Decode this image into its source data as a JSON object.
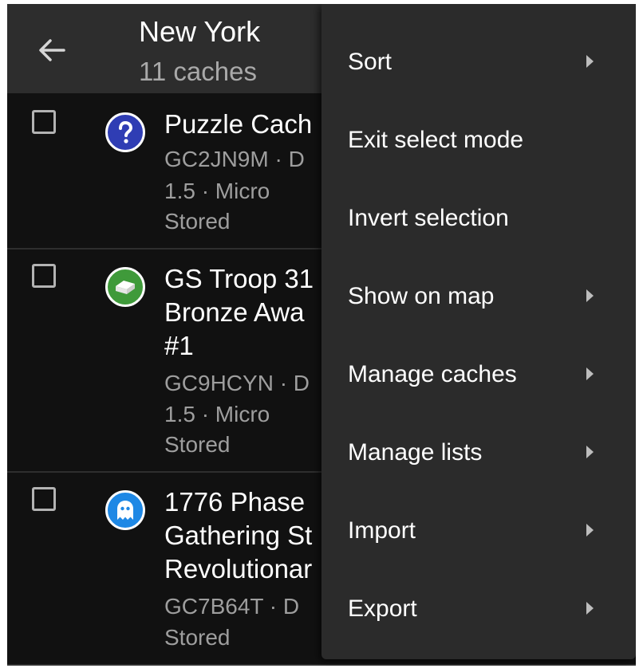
{
  "appbar": {
    "title": "New York",
    "subtitle": "11 caches",
    "back_icon": "arrow-left-icon"
  },
  "caches": [
    {
      "name": "Puzzle Cach",
      "details": [
        "GC2JN9M · D",
        "1.5 · Micro",
        "Stored"
      ],
      "type_icon": "question-mark-icon",
      "icon_color": "#2f3db4",
      "checked": false
    },
    {
      "name_lines": [
        "GS Troop 31",
        "Bronze Awa",
        "#1"
      ],
      "details": [
        "GC9HCYN · D",
        "1.5 · Micro",
        "Stored"
      ],
      "type_icon": "traditional-box-icon",
      "icon_color": "#3f9a3a",
      "checked": false
    },
    {
      "name_lines": [
        "1776 Phase",
        "Gathering St",
        "Revolutionar"
      ],
      "details": [
        "GC7B64T · D",
        "Stored"
      ],
      "type_icon": "ghost-icon",
      "icon_color": "#1e88e5",
      "checked": false
    }
  ],
  "menu": {
    "items": [
      {
        "label": "Sort",
        "has_submenu": true
      },
      {
        "label": "Exit select mode",
        "has_submenu": false
      },
      {
        "label": "Invert selection",
        "has_submenu": false
      },
      {
        "label": "Show on map",
        "has_submenu": true
      },
      {
        "label": "Manage caches",
        "has_submenu": true
      },
      {
        "label": "Manage lists",
        "has_submenu": true
      },
      {
        "label": "Import",
        "has_submenu": true
      },
      {
        "label": "Export",
        "has_submenu": true
      }
    ]
  }
}
